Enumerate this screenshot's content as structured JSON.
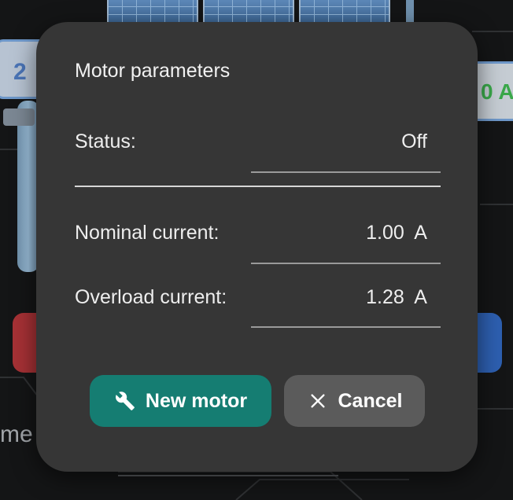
{
  "background": {
    "left_value": "2",
    "right_value": "0 A",
    "bottom_text": "me"
  },
  "dialog": {
    "title": "Motor parameters",
    "rows": [
      {
        "label": "Status:",
        "value": "Off"
      },
      {
        "label": "Nominal current:",
        "value": "1.00  A"
      },
      {
        "label": "Overload current:",
        "value": "1.28  A"
      }
    ],
    "buttons": {
      "new_motor": {
        "label": "New motor",
        "icon": "wrench-icon"
      },
      "cancel": {
        "label": "Cancel",
        "icon": "close-icon"
      }
    }
  },
  "colors": {
    "dialog_bg": "#363636",
    "primary_button": "#157d72",
    "secondary_button": "#5b5b5b"
  }
}
